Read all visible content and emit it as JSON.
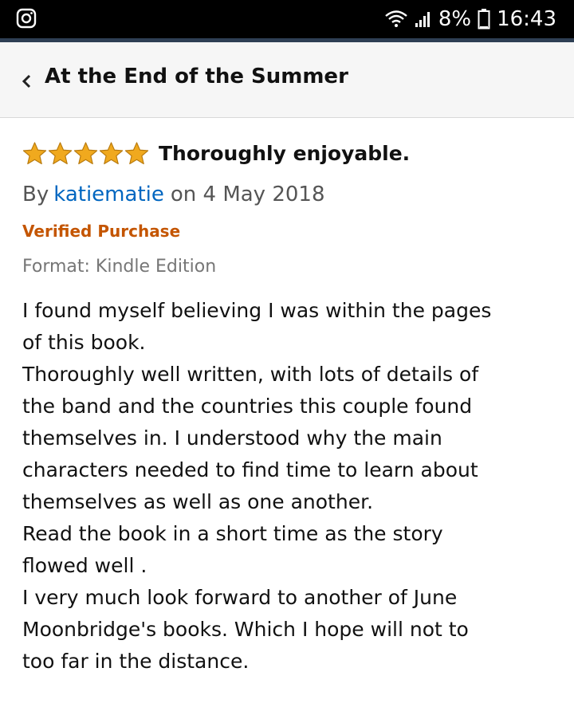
{
  "status_bar": {
    "battery": "8%",
    "time": "16:43",
    "icons": [
      "instagram-icon",
      "wifi-icon",
      "signal-icon",
      "battery-icon"
    ]
  },
  "header": {
    "title": "At the End of the Summer",
    "back_icon": "chevron-left-icon"
  },
  "review": {
    "rating": 5,
    "rating_max": 5,
    "star_color": "#f0a91e",
    "title": "Thoroughly enjoyable.",
    "by_label": "By",
    "author": "katiematie",
    "date": "on 4 May 2018",
    "verified": "Verified Purchase",
    "format": "Format: Kindle Edition",
    "body_lines": [
      "I found myself believing I was within the pages",
      "of this book.",
      "Thoroughly well written, with lots of details of",
      "the band and the countries this couple found",
      "themselves in. I understood why the main",
      "characters needed to find time to learn about",
      "themselves as well as one another.",
      "Read the book in a short time as the story",
      "flowed well .",
      "I very much look forward to another of June",
      "Moonbridge's books. Which I hope will not to",
      "too far in the distance."
    ]
  },
  "colors": {
    "link": "#0066c0",
    "verified": "#c45500",
    "header_bg": "#f6f6f6"
  }
}
